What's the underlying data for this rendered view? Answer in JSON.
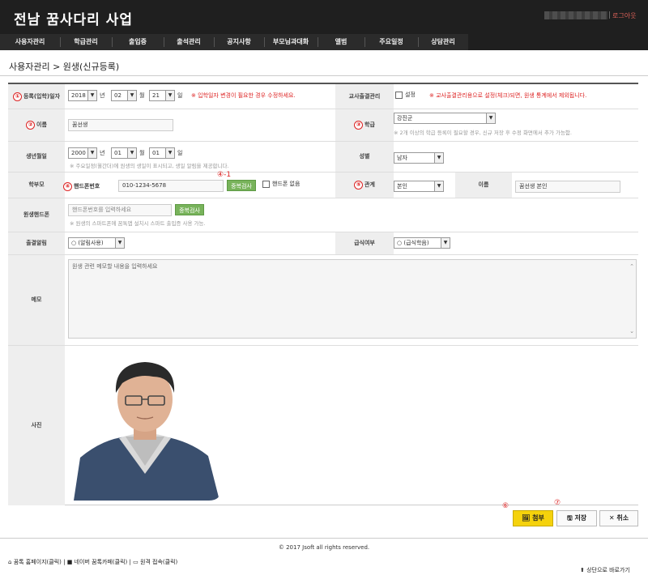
{
  "header": {
    "title": "전남 꿈사다리 사업",
    "logout": "로그아웃"
  },
  "nav": [
    "사용자관리",
    "학급관리",
    "출입증",
    "출석관리",
    "공지사항",
    "부모님과대화",
    "앨범",
    "주요일정",
    "상담관리"
  ],
  "breadcrumb": "사용자관리 > 원생(신규등록)",
  "form": {
    "entry_date": {
      "badge": "①",
      "label": "등록(입학)일자",
      "year": "2018",
      "year_unit": "년",
      "month": "02",
      "month_unit": "월",
      "day": "21",
      "day_unit": "일",
      "warning": "※ 입학일자 변경이 필요한 경우 수정하세요."
    },
    "teacher_attendance": {
      "label": "교사출결관리",
      "checkbox_label": "설정",
      "warning": "※ 교사출결관리용으로 설정(체크)되면, 원생 통계에서 제외됩니다."
    },
    "name": {
      "badge": "②",
      "label": "이름",
      "value": "꿈선생"
    },
    "class": {
      "badge": "③",
      "label": "학급",
      "value": "강진군",
      "note": "※ 2개 이상의 학급 등록이 필요할 경우, 신규 저장 후 수정 화면에서 추가 가능함."
    },
    "birth": {
      "label": "생년월일",
      "year": "2000",
      "year_unit": "년",
      "month": "01",
      "month_unit": "월",
      "day": "01",
      "day_unit": "일",
      "note": "※ 주요일정(월간더)에 원생의 생일이 표시되고, 생일 알림을 제공합니다."
    },
    "gender": {
      "label": "성별",
      "value": "남자"
    },
    "parent": {
      "label": "학부모",
      "phone_badge": "④",
      "phone_label": "핸드폰번호",
      "phone_value": "010-1234-5678",
      "dup_badge": "④-1",
      "dup_button": "중복검사",
      "no_phone_label": "핸드폰 없음"
    },
    "relation": {
      "badge": "⑤",
      "label": "관계",
      "value": "본인",
      "name_label": "이름",
      "name_value": "꿈선생 본인"
    },
    "student_phone": {
      "label": "원생핸드폰",
      "placeholder": "핸드폰번호를 입력하세요",
      "dup_button": "중복검사",
      "note": "※ 원생의 스마트폰에 꿈톡앱 설치시 스마트 출입증 사용 가능."
    },
    "attendance_alert": {
      "label": "출결알림",
      "value": "○ (알림사용)"
    },
    "meal": {
      "label": "급식여부",
      "value": "○ (급식학음)"
    },
    "memo": {
      "label": "메모",
      "placeholder": "원생 관련 메모할 내용을 입력하세요"
    },
    "photo": {
      "label": "사진"
    }
  },
  "buttons": {
    "attach_badge": "⑥",
    "attach": "첨부",
    "save_badge": "⑦",
    "save": "저장",
    "cancel": "취소"
  },
  "footer": {
    "copyright": "© 2017 Jsoft all rights reserved.",
    "links": [
      "꿈톡 홈페이지(클릭)",
      "네이버 꿈톡카페(클릭)",
      "원격 접속(클릭)"
    ],
    "to_top": "상단으로 바로가기"
  }
}
